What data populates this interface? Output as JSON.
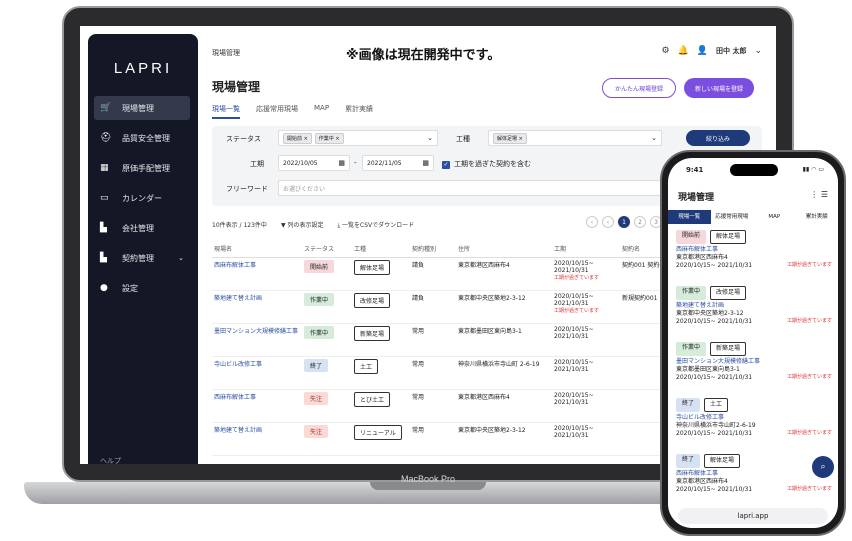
{
  "dev_note": "※画像は現在開発中です。",
  "laptop": {
    "label": "MacBook Pro"
  },
  "sidebar": {
    "logo": "LAPRI",
    "items": [
      {
        "label": "現場管理",
        "icon": "cart-icon"
      },
      {
        "label": "品質安全管理",
        "icon": "helmet-icon"
      },
      {
        "label": "原価手配管理",
        "icon": "calculator-icon"
      },
      {
        "label": "カレンダー",
        "icon": "calendar-icon"
      },
      {
        "label": "会社管理",
        "icon": "building-icon"
      },
      {
        "label": "契約管理",
        "icon": "contract-icon"
      },
      {
        "label": "設定",
        "icon": "person-icon"
      }
    ],
    "help": "ヘルプ"
  },
  "header": {
    "breadcrumb": "現場管理",
    "user_name": "田中 太郎",
    "page_title": "現場管理",
    "btn_simple": "かんたん現場登録",
    "btn_new": "新しい現場を登録"
  },
  "tabs": [
    "現場一覧",
    "応援常用現場",
    "MAP",
    "累計実績"
  ],
  "filter": {
    "status_label": "ステータス",
    "status_chips": [
      "開始前",
      "作業中"
    ],
    "type_label": "工種",
    "type_chips": [
      "解体足場"
    ],
    "period_label": "工期",
    "date_from": "2022/10/05",
    "date_sep": "-",
    "date_to": "2022/11/05",
    "include_label": "工期を過ぎた契約を含む",
    "freeword_label": "フリーワード",
    "freeword_placeholder": "お選びください",
    "search_btn": "絞り込み"
  },
  "results": {
    "count_text": "10件表示 / 123件中",
    "display_setting": "列の表示設定",
    "csv_download": "一覧をCSVでダウンロード",
    "pages": [
      "1",
      "2",
      "3"
    ]
  },
  "table": {
    "headers": [
      "現場名",
      "ステータス",
      "工種",
      "契約種別",
      "住所",
      "工期",
      "契約名"
    ],
    "rows": [
      {
        "name": "西麻布解体工事",
        "status": "開始前",
        "status_color": "pink",
        "work": "解体足場",
        "contract": "請負",
        "address": "東京都港区西麻布4",
        "period": "2020/10/15~ 2021/10/31",
        "warn": "工期が過ぎています",
        "cname": "契約001 契約002 他3件"
      },
      {
        "name": "築地建て替え計画",
        "status": "作業中",
        "status_color": "green",
        "work": "改修足場",
        "contract": "請負",
        "address": "東京都中央区築地2-3-12",
        "period": "2020/10/15~ 2021/10/31",
        "warn": "工期が過ぎています",
        "cname": "新規契約001"
      },
      {
        "name": "墨田マンション大規模修繕工事",
        "status": "作業中",
        "status_color": "green",
        "work": "新築足場",
        "contract": "常用",
        "address": "東京都墨田区東向島3-1",
        "period": "2020/10/15~ 2021/10/31",
        "warn": "",
        "cname": ""
      },
      {
        "name": "寺山ビル改修工事",
        "status": "終了",
        "status_color": "blue",
        "work": "土工",
        "contract": "常用",
        "address": "神奈川県横浜市寺山町 2-6-19",
        "period": "2020/10/15~ 2021/10/31",
        "warn": "",
        "cname": ""
      },
      {
        "name": "西麻布解体工事",
        "status": "失注",
        "status_color": "red",
        "work": "とび土工",
        "contract": "常用",
        "address": "東京都港区西麻布4",
        "period": "2020/10/15~ 2021/10/31",
        "warn": "",
        "cname": ""
      },
      {
        "name": "築地建て替え計画",
        "status": "失注",
        "status_color": "red",
        "work": "リニューアル",
        "contract": "常用",
        "address": "東京都中央区築地2-3-12",
        "period": "2020/10/15~ 2021/10/31",
        "warn": "",
        "cname": ""
      }
    ]
  },
  "phone": {
    "time": "9:41",
    "title": "現場管理",
    "tabs": [
      "現場一覧",
      "応援常用現場",
      "MAP",
      "累計実績"
    ],
    "items": [
      {
        "status": "開始前",
        "work": "解体足場",
        "name": "西麻布解体工事",
        "address": "東京都港区西麻布4",
        "period": "2020/10/15~ 2021/10/31",
        "warn": "工期が過ぎています"
      },
      {
        "status": "作業中",
        "work": "改修足場",
        "name": "築地建て替え計画",
        "address": "東京都中央区築地2-3-12",
        "period": "2020/10/15~ 2021/10/31",
        "warn": "工期が過ぎています"
      },
      {
        "status": "作業中",
        "work": "新築足場",
        "name": "墨田マンション大規模修繕工事",
        "address": "東京都墨田区東向島3-1",
        "period": "2020/10/15~ 2021/10/31",
        "warn": "工期が過ぎています"
      },
      {
        "status": "終了",
        "work": "土工",
        "name": "寺山ビル改修工事",
        "address": "神奈川県横浜市寺山町2-6-19",
        "period": "2020/10/15~ 2021/10/31",
        "warn": "工期が過ぎています"
      },
      {
        "status": "終了",
        "work": "解体足場",
        "name": "西麻布解体工事",
        "address": "東京都港区西麻布4",
        "period": "2020/10/15~ 2021/10/31",
        "warn": "工期が過ぎています"
      }
    ],
    "url": "lapri.app"
  }
}
